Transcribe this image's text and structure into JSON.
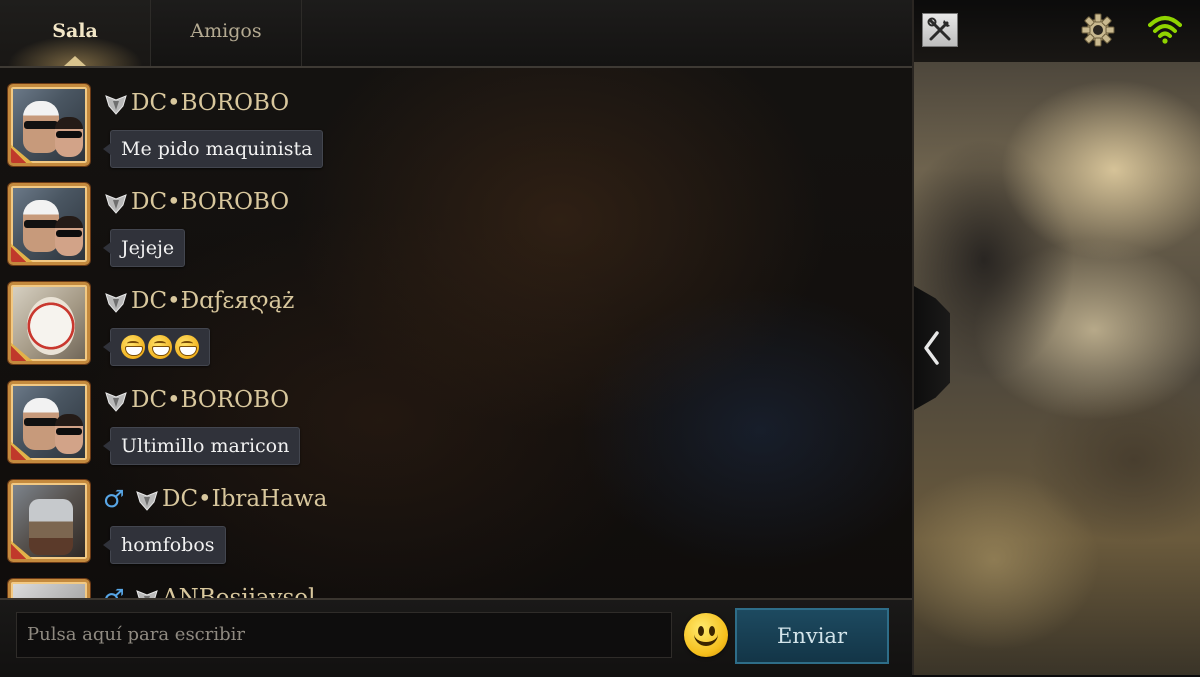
{
  "tabs": {
    "sala": "Sala",
    "amigos": "Amigos"
  },
  "messages": [
    {
      "sender": "DC•BOROBO",
      "text": "Me pido maquinista",
      "gender": ""
    },
    {
      "sender": "DC•BOROBO",
      "text": "Jejeje",
      "gender": ""
    },
    {
      "sender": "DC•Ðɑƒɛяღąż",
      "text": "",
      "emoji": "grinning-face x3",
      "gender": ""
    },
    {
      "sender": "DC•BOROBO",
      "text": "Ultimillo maricon",
      "gender": ""
    },
    {
      "sender": "DC•IbraHawa",
      "text": "homfobos",
      "gender": "♂"
    },
    {
      "sender": "ANBosijaysol",
      "text": "",
      "gender": "♂"
    }
  ],
  "input": {
    "placeholder": "Pulsa aquí para escribir",
    "send_label": "Enviar"
  },
  "icons": {
    "tools": "tools-icon",
    "settings": "gear-icon",
    "wifi": "wifi-icon",
    "collapse": "chevron-left-icon",
    "emoji": "smiley-icon"
  },
  "colors": {
    "name_gold": "#d8c79d",
    "gender_blue": "#58a6e6",
    "wifi_green": "#8fd400",
    "send_teal": "#1d4a60"
  }
}
